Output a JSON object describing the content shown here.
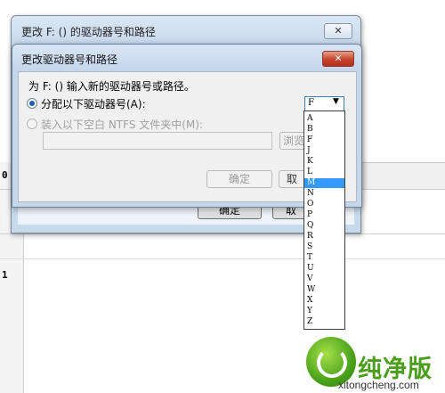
{
  "background": {
    "row_numbers": [
      "0",
      "1"
    ]
  },
  "outer_dialog": {
    "title": "更改 F: () 的驱动器号和路径",
    "close_glyph": "✕",
    "ok_label": "确定",
    "cancel_label": "取"
  },
  "inner_dialog": {
    "title": "更改驱动器号和路径",
    "close_glyph": "✕",
    "prompt": "为 F: () 输入新的驱动器号或路径。",
    "option_assign": "分配以下驱动器号(A):",
    "option_mount": "装入以下空白 NTFS 文件夹中(M):",
    "browse_label": "浏览",
    "ok_label": "确定",
    "cancel_label": "取",
    "drive_select_value": "F"
  },
  "drive_letters": [
    "A",
    "B",
    "F",
    "J",
    "K",
    "L",
    "M",
    "N",
    "O",
    "P",
    "Q",
    "R",
    "S",
    "T",
    "U",
    "V",
    "W",
    "X",
    "Y",
    "Z"
  ],
  "selected_letter": "M",
  "watermark": {
    "brand": "纯净版",
    "url": "xitongcheng.com"
  },
  "colors": {
    "selection": "#3399ff",
    "close_red": "#c7422b",
    "brand_green": "#4b9d1c"
  }
}
